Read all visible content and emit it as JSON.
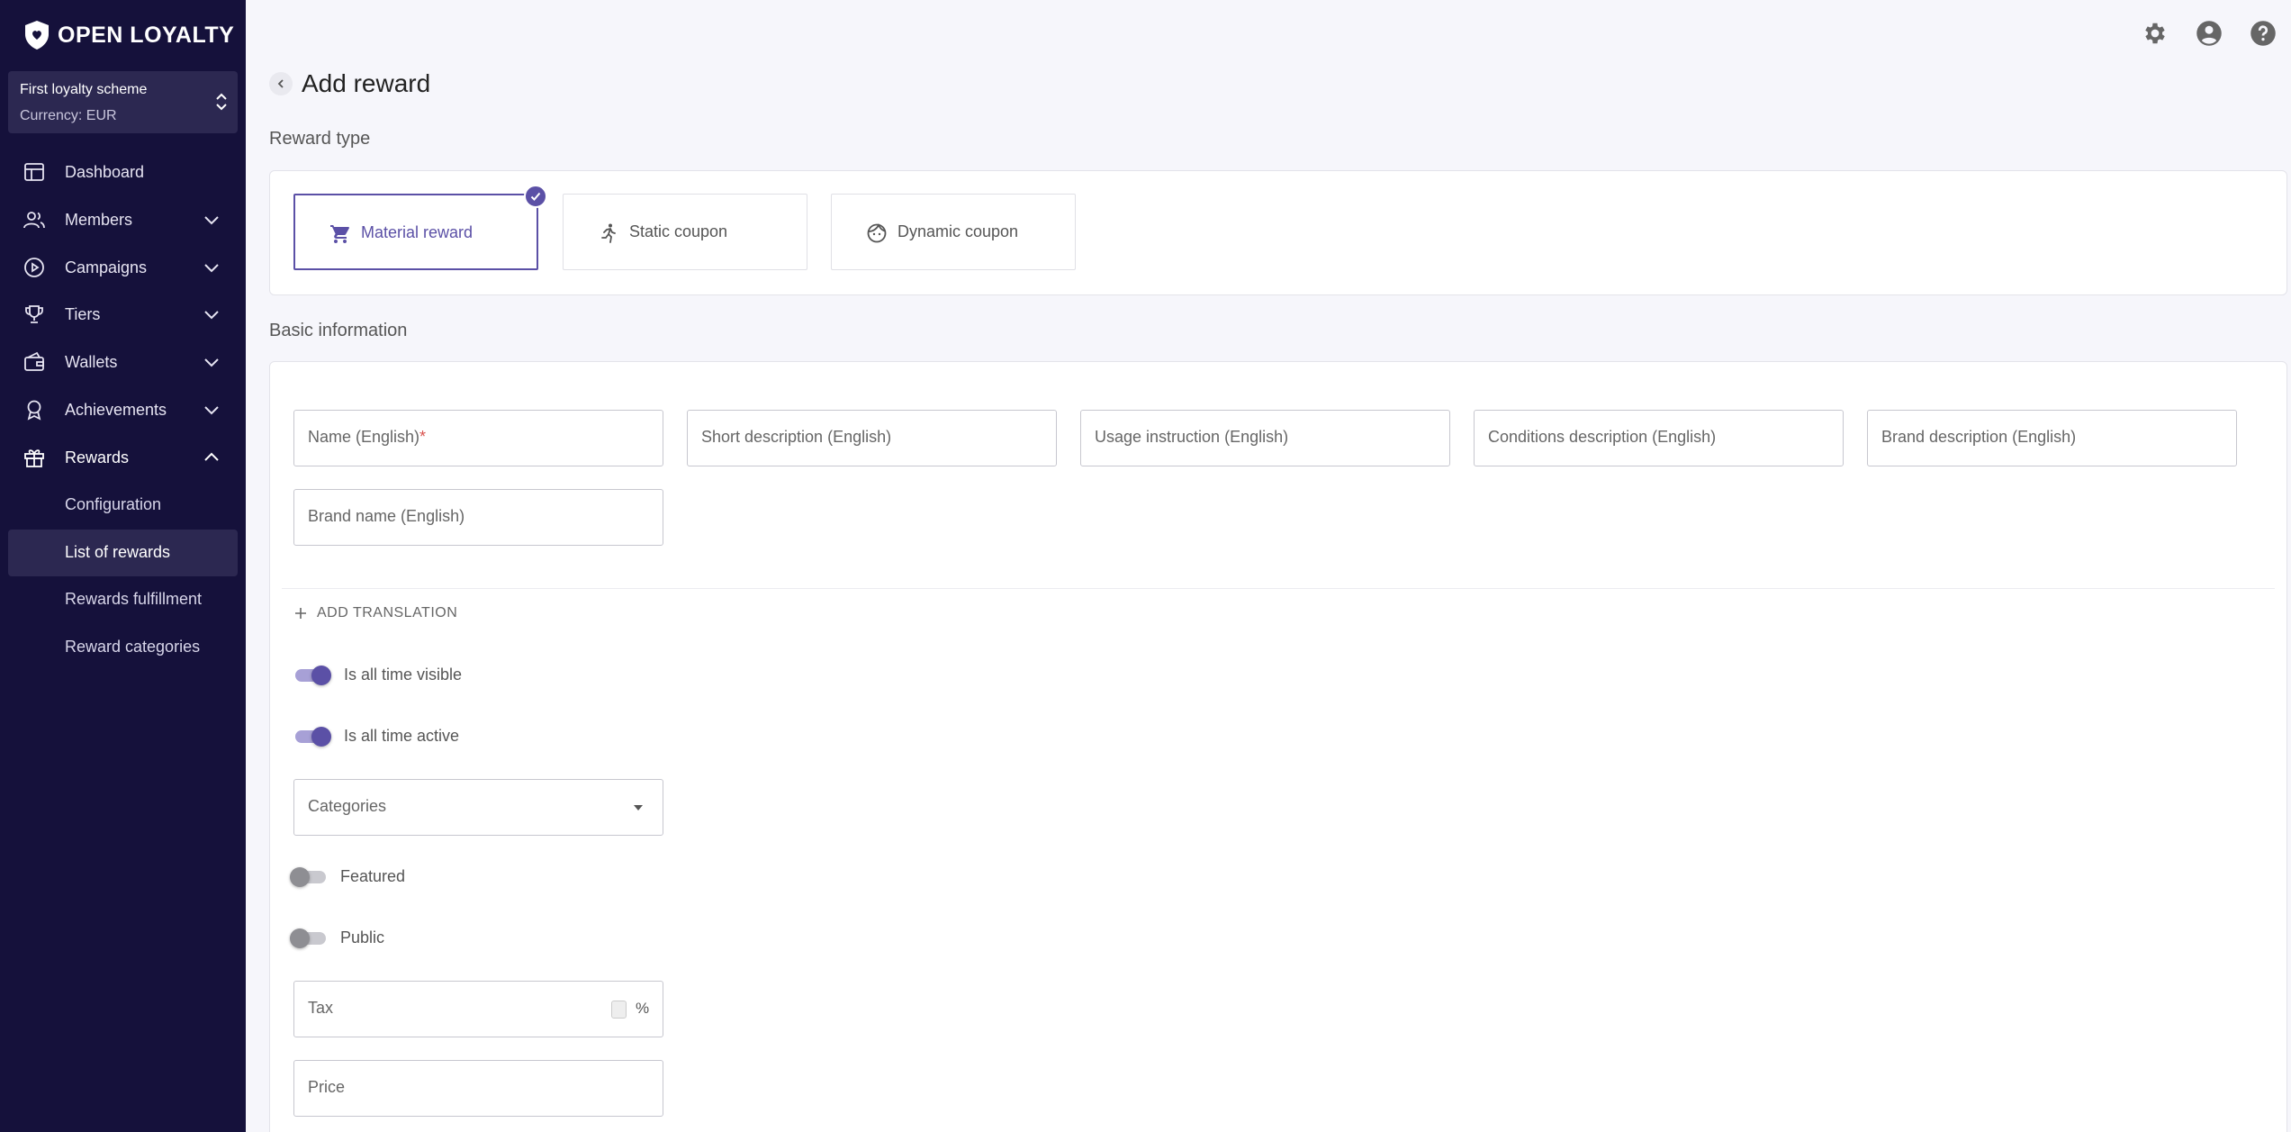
{
  "brand": {
    "name": "OPEN LOYALTY"
  },
  "scheme": {
    "name": "First loyalty scheme",
    "currency": "Currency: EUR"
  },
  "sidebar": {
    "items": [
      {
        "label": "Dashboard",
        "icon": "dashboard-icon"
      },
      {
        "label": "Members",
        "icon": "members-icon"
      },
      {
        "label": "Campaigns",
        "icon": "campaigns-icon"
      },
      {
        "label": "Tiers",
        "icon": "trophy-icon"
      },
      {
        "label": "Wallets",
        "icon": "wallet-icon"
      },
      {
        "label": "Achievements",
        "icon": "badge-icon"
      },
      {
        "label": "Rewards",
        "icon": "gift-icon"
      }
    ],
    "sub_items": [
      {
        "label": "Configuration"
      },
      {
        "label": "List of rewards"
      },
      {
        "label": "Rewards fulfillment"
      },
      {
        "label": "Reward categories"
      }
    ]
  },
  "header": {
    "icons": [
      "settings-icon",
      "account-icon",
      "help-icon"
    ]
  },
  "page": {
    "title": "Add reward"
  },
  "reward_type": {
    "section_title": "Reward type",
    "options": [
      {
        "label": "Material reward",
        "icon": "cart-icon",
        "selected": true
      },
      {
        "label": "Static coupon",
        "icon": "runner-icon",
        "selected": false
      },
      {
        "label": "Dynamic coupon",
        "icon": "face-icon",
        "selected": false
      }
    ]
  },
  "basic_info": {
    "section_title": "Basic information",
    "fields": {
      "name": "Name (English)",
      "name_required": "*",
      "short_description": "Short description (English)",
      "usage_instruction": "Usage instruction (English)",
      "conditions_description": "Conditions description (English)",
      "brand_description": "Brand description (English)",
      "brand_name": "Brand name (English)"
    },
    "add_translation": "ADD TRANSLATION",
    "toggles": {
      "all_time_visible": {
        "label": "Is all time visible",
        "on": true
      },
      "all_time_active": {
        "label": "Is all time active",
        "on": true
      },
      "featured": {
        "label": "Featured",
        "on": false
      },
      "public": {
        "label": "Public",
        "on": false
      }
    },
    "categories_label": "Categories",
    "tax_label": "Tax",
    "tax_unit": "%",
    "price_label": "Price"
  },
  "colors": {
    "sidebar_bg": "#15113b",
    "accent": "#5b50a6",
    "page_bg": "#f6f6fb"
  }
}
